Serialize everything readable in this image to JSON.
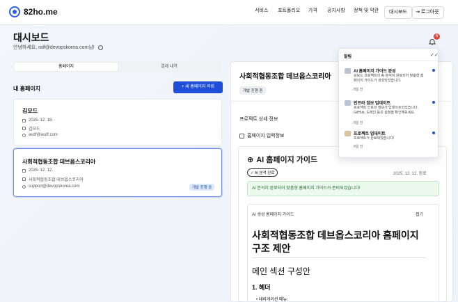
{
  "brand": {
    "name": "82ho.me"
  },
  "nav": {
    "items": [
      "서비스",
      "포트폴리오",
      "가격",
      "공지사항",
      "정책 및 약관"
    ],
    "dashboard": "대시보드",
    "logout": "로그아웃"
  },
  "page": {
    "title": "대시보드",
    "greeting": "안녕하세요, ralf@devopskorea.com님!"
  },
  "bell": {
    "count": "6"
  },
  "tabs": [
    "홈페이지",
    "결제 내역"
  ],
  "left": {
    "section_title": "내 홈페이지",
    "new_button": "+  새 홈페이지 의뢰"
  },
  "cards": [
    {
      "title": "김모드",
      "date": "2025. 12. 18.",
      "org": "김모드",
      "email": "asdf@asdf.com"
    },
    {
      "title": "사회적협동조합 데브옵스코리아",
      "date": "2025. 12. 12.",
      "org": "사회적협동조합 데브옵스코리아",
      "email": "support@devopskorea.com",
      "status": "개발 진행 중"
    }
  ],
  "detail": {
    "title": "사회적협동조합 데브옵스코리아",
    "status": "개발 진행 중",
    "project_info": "프로젝트 상세 정보",
    "input_info": "홈페이지 입력정보"
  },
  "guide": {
    "title": "AI 홈페이지 가이드",
    "done_badge": "AI 분석 완료",
    "date": "2025. 12. 12. 완료",
    "success": "AI 분석이 완료되어 맞춤형 홈페이지 가이드가 준비되었습니다!",
    "inner_header": "AI 생성 홈페이지 가이드",
    "fold": "접기",
    "body_title": "사회적협동조합 데브옵스코리아 홈페이지 구조 제안",
    "section": "메인 섹션 구성안",
    "h3": "1. 헤더",
    "li": "네비게이션 메뉴:"
  },
  "notifications": {
    "header": "알림",
    "items": [
      {
        "title": "AI 홈페이지 가이드 완성",
        "body": "김모드 프로젝트의 AI 분석이 완료되어 맞춤형 홈페이지 가이드가 생성되었습니다.",
        "time": "8일 전"
      },
      {
        "title": "인프라 정보 업데이트",
        "body": "프로젝트 인프라 정보가 업데이트되었습니다. GitHub, 도메인 등의 설정을 확인해보세요.",
        "time": "8일 전"
      },
      {
        "title": "프로젝트 업데이트",
        "body": "프로젝트가 완료되었습니다!",
        "time": "8일 전"
      }
    ]
  }
}
